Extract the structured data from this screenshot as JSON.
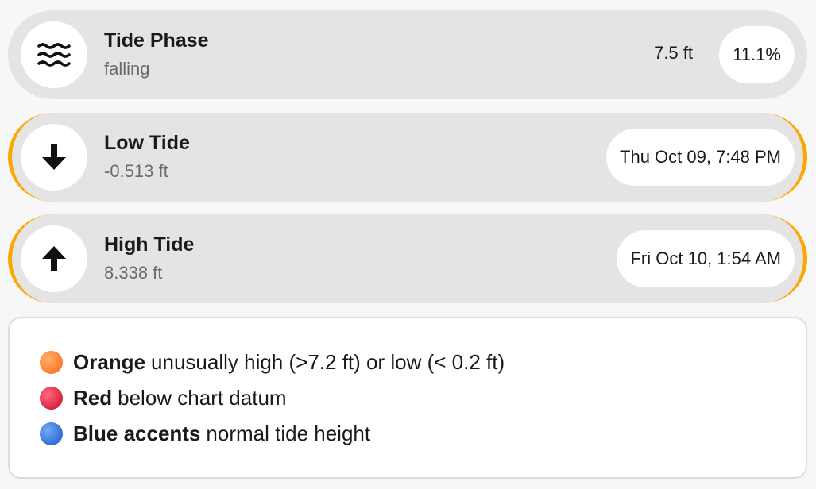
{
  "phase_card": {
    "title": "Tide Phase",
    "subtitle": "falling",
    "height": "7.5 ft",
    "percent": "11.1%",
    "icon": "waves-icon"
  },
  "low_card": {
    "title": "Low Tide",
    "subtitle": "-0.513 ft",
    "time": "Thu Oct 09, 7:48 PM",
    "icon": "arrow-down-icon"
  },
  "high_card": {
    "title": "High Tide",
    "subtitle": "8.338 ft",
    "time": "Fri Oct 10, 1:54 AM",
    "icon": "arrow-up-icon"
  },
  "legend": {
    "items": [
      {
        "label": "Orange",
        "text": "unusually high (>7.2 ft) or low (< 0.2 ft)",
        "color": "#ff8c3a"
      },
      {
        "label": "Red",
        "text": "below chart datum",
        "color": "#e0344e"
      },
      {
        "label": "Blue accents",
        "text": "normal tide height",
        "color": "#3b7de0"
      }
    ]
  },
  "colors": {
    "accent": "#ffa500",
    "card_bg": "#e4e4e4"
  }
}
